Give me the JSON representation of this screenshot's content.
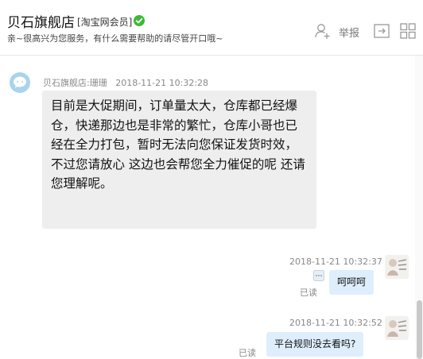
{
  "header": {
    "shop_name": "贝石旗舰店",
    "member_tag": "[淘宝网会员]",
    "subtitle": "亲~很高兴为您服务，有什么需要帮助的请尽管开口哦~",
    "report_label": "举报"
  },
  "messages": [
    {
      "direction": "incoming",
      "sender": "贝石旗舰店:珊珊",
      "time": "2018-11-21 10:32:28",
      "text": "目前是大促期间，订单量太大，仓库都已经爆仓，快递那边也是非常的繁忙，仓库小哥也已经在全力打包，暂时无法向您保证发货时效，不过您请放心 这边也会帮您全力催促的呢 还请您理解呢。"
    },
    {
      "direction": "outgoing",
      "time": "2018-11-21 10:32:37",
      "text": "呵呵呵",
      "status": "已读"
    },
    {
      "direction": "outgoing",
      "time": "2018-11-21 10:32:52",
      "text": "平台规则没去看吗?",
      "status": "已读"
    }
  ],
  "colors": {
    "incoming_bubble": "#eeeeee",
    "outgoing_bubble": "#dfeefd",
    "verify_badge": "#3cba37"
  }
}
